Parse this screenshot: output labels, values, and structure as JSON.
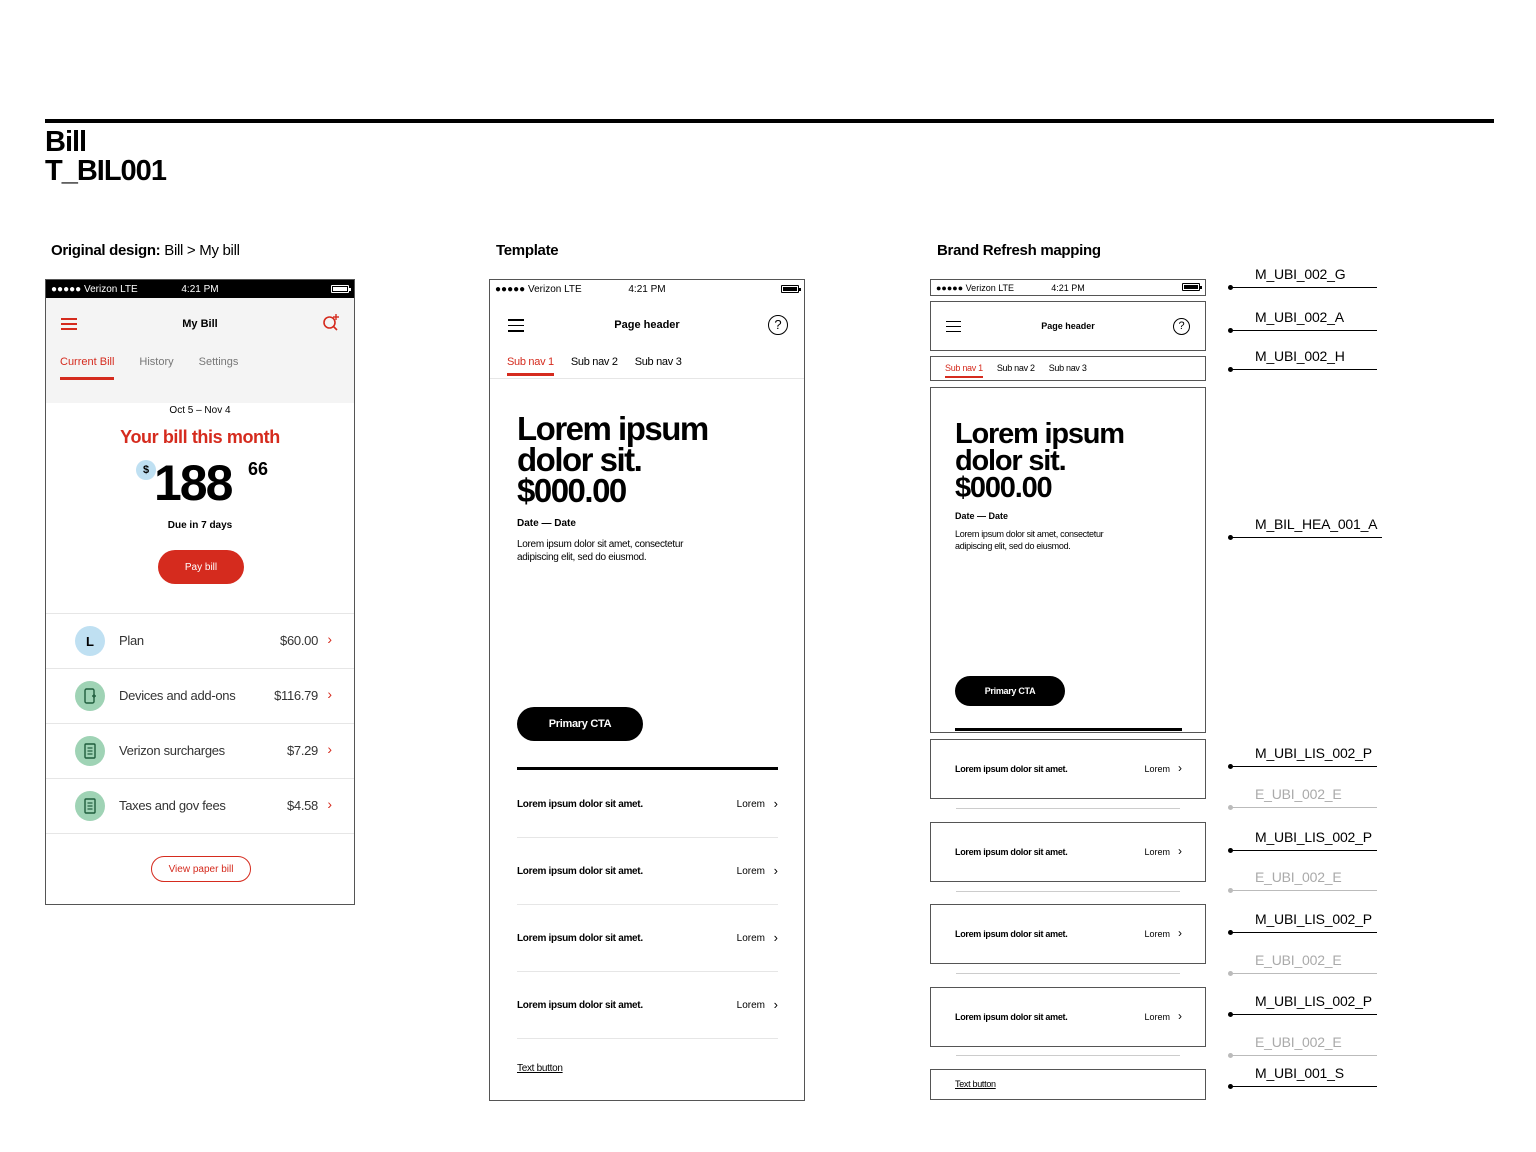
{
  "header": {
    "title": "Bill",
    "code": "T_BIL001"
  },
  "columns": {
    "original_bold": "Original design:",
    "original_normal": " Bill > My bill",
    "template": "Template",
    "brand": "Brand Refresh mapping"
  },
  "original": {
    "status": {
      "carrier": "●●●●● Verizon  LTE",
      "time": "4:21 PM"
    },
    "nav_title": "My Bill",
    "tabs": [
      "Current Bill",
      "History",
      "Settings"
    ],
    "period": "Oct 5  –  Nov 4",
    "headline": "Your bill this month",
    "currency": "$",
    "amount_whole": "188",
    "amount_cents": "66",
    "due": "Due in 7 days",
    "pay_label": "Pay bill",
    "items": [
      {
        "label": "Plan",
        "value": "$60.00",
        "badge": "L",
        "color": "#bfe0f2"
      },
      {
        "label": "Devices and add-ons",
        "value": "$116.79",
        "icon": "device-icon",
        "color": "#9fd3b5"
      },
      {
        "label": "Verizon surcharges",
        "value": "$7.29",
        "icon": "document-icon",
        "color": "#9fd3b5"
      },
      {
        "label": "Taxes and gov fees",
        "value": "$4.58",
        "icon": "document-icon",
        "color": "#9fd3b5"
      }
    ],
    "paper_label": "View paper bill",
    "accent": "#d52b1e"
  },
  "template": {
    "status": {
      "carrier": "●●●●● Verizon  LTE",
      "time": "4:21 PM"
    },
    "nav_title": "Page header",
    "subnav": [
      "Sub nav 1",
      "Sub nav 2",
      "Sub nav 3"
    ],
    "hero_line1": "Lorem ipsum",
    "hero_line2": "dolor sit.",
    "hero_line3": "$000.00",
    "date_range": "Date  —  Date",
    "description": "Lorem ipsum dolor sit amet, consectetur adipiscing elit, sed do eiusmod.",
    "cta_label": "Primary CTA",
    "rows": [
      {
        "label": "Lorem ipsum dolor sit amet.",
        "value": "Lorem"
      },
      {
        "label": "Lorem ipsum dolor sit amet.",
        "value": "Lorem"
      },
      {
        "label": "Lorem ipsum dolor sit amet.",
        "value": "Lorem"
      },
      {
        "label": "Lorem ipsum dolor sit amet.",
        "value": "Lorem"
      }
    ],
    "text_button": "Text button"
  },
  "mapping_labels": [
    "M_UBI_002_G",
    "M_UBI_002_A",
    "M_UBI_002_H",
    "M_BIL_HEA_001_A",
    "M_UBI_LIS_002_P",
    "E_UBI_002_E",
    "M_UBI_LIS_002_P",
    "E_UBI_002_E",
    "M_UBI_LIS_002_P",
    "E_UBI_002_E",
    "M_UBI_LIS_002_P",
    "E_UBI_002_E",
    "M_UBI_001_S"
  ],
  "chevron": "›"
}
